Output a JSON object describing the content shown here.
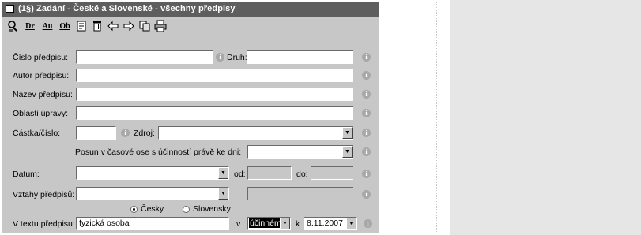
{
  "window": {
    "title": "(1§)  Zadání - České a Slovenské - všechny předpisy"
  },
  "toolbar": {
    "icons": [
      "search-icon",
      "dr-icon",
      "au-icon",
      "ob-icon",
      "document-icon",
      "delete-icon",
      "back-icon",
      "forward-icon",
      "copy-icon",
      "print-icon"
    ],
    "dr": "Dr",
    "au": "Au",
    "ob": "Ob"
  },
  "form": {
    "cislo_predpisu": {
      "label": "Číslo předpisu:",
      "value": ""
    },
    "druh": {
      "label": "Druh:",
      "value": ""
    },
    "autor_predpisu": {
      "label": "Autor předpisu:",
      "value": ""
    },
    "nazev_predpisu": {
      "label": "Název předpisu:",
      "value": ""
    },
    "oblasti_upravy": {
      "label": "Oblasti úpravy:",
      "value": ""
    },
    "castka_cislo": {
      "label": "Částka/číslo:",
      "value": ""
    },
    "zdroj": {
      "label": "Zdroj:",
      "value": ""
    },
    "posun": {
      "label": "Posun v časové ose s účinností právě ke dni:",
      "value": ""
    },
    "datum": {
      "label": "Datum:",
      "value": "",
      "od_label": "od:",
      "od_value": "",
      "do_label": "do:",
      "do_value": ""
    },
    "vztahy_predpisu": {
      "label": "Vztahy předpisů:",
      "value": "",
      "extra_value": ""
    },
    "language": {
      "option_cz": "Česky",
      "option_sk": "Slovensky",
      "selected": "Česky"
    },
    "text_predpisu": {
      "label": "V textu předpisu:",
      "value": "fyzická osoba",
      "v_label": "v",
      "mode": "účinném",
      "k_label": "k",
      "date": "8.11.2007"
    }
  },
  "info_glyph": "i",
  "arrow_glyph": "▼"
}
